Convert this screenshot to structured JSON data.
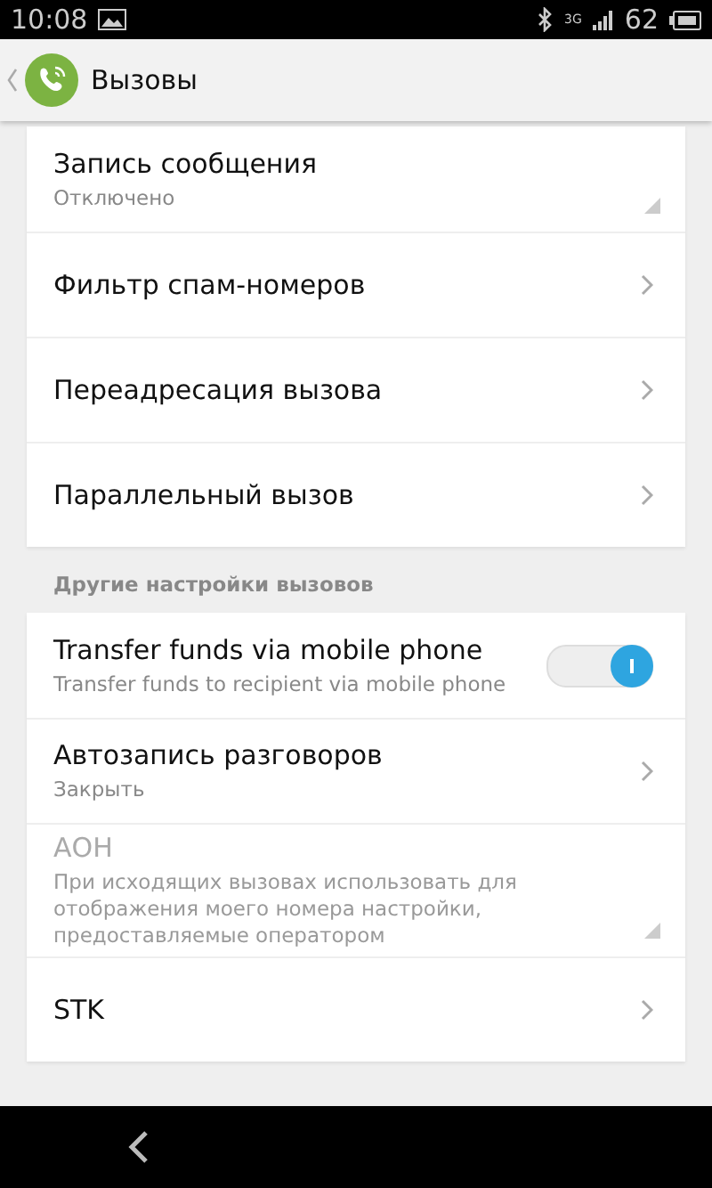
{
  "status_bar": {
    "time": "10:08",
    "network": "3G",
    "battery": "62"
  },
  "app_bar": {
    "title": "Вызовы"
  },
  "sections": [
    {
      "items": [
        {
          "kind": "dropdown",
          "title": "Запись сообщения",
          "subtitle": "Отключено",
          "disabled": false
        },
        {
          "kind": "link",
          "title": "Фильтр спам-номеров",
          "disabled": false
        },
        {
          "kind": "link",
          "title": "Переадресация вызова",
          "disabled": false
        },
        {
          "kind": "link",
          "title": "Параллельный вызов",
          "disabled": false
        }
      ]
    },
    {
      "header": "Другие настройки вызовов",
      "items": [
        {
          "kind": "toggle",
          "title": "Transfer funds via mobile phone",
          "subtitle": "Transfer funds to recipient via mobile phone",
          "on": true,
          "disabled": false
        },
        {
          "kind": "link",
          "title": "Автозапись разговоров",
          "subtitle": "Закрыть",
          "disabled": false
        },
        {
          "kind": "dropdown",
          "title": "АОН",
          "subtitle": "При исходящих вызовах использовать для отображения моего номера настройки, предоставляемые оператором",
          "disabled": true
        },
        {
          "kind": "link",
          "title": "STK",
          "disabled": false
        }
      ]
    }
  ]
}
